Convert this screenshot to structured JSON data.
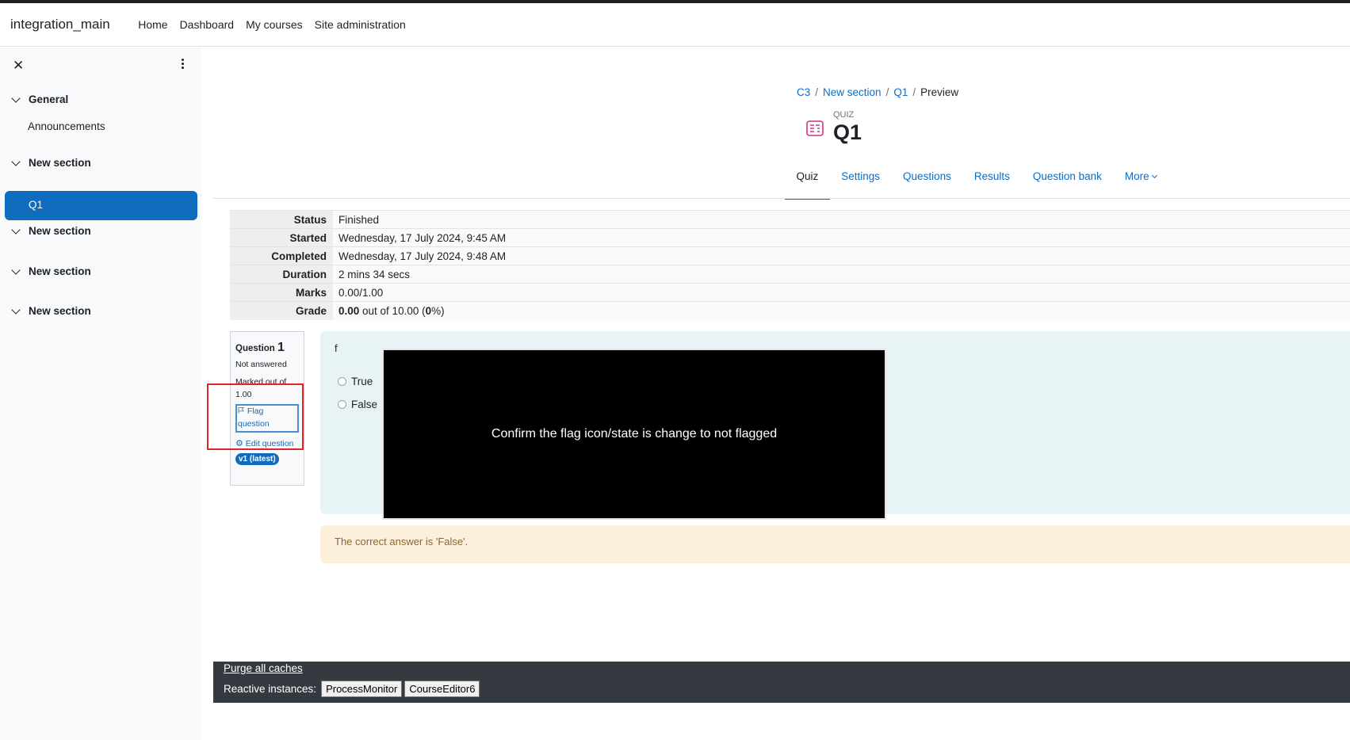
{
  "navbar": {
    "brand": "integration_main",
    "links": [
      "Home",
      "Dashboard",
      "My courses",
      "Site administration"
    ]
  },
  "drawer": {
    "close_glyph": "✕",
    "sections": [
      {
        "label": "General",
        "items": [
          "Announcements"
        ]
      },
      {
        "label": "New section",
        "items": [
          "Q1"
        ]
      },
      {
        "label": "New section",
        "items": []
      },
      {
        "label": "New section",
        "items": []
      },
      {
        "label": "New section",
        "items": []
      }
    ],
    "active_item": "Q1"
  },
  "breadcrumb": [
    "C3",
    "New section",
    "Q1",
    "Preview"
  ],
  "quiz": {
    "kind": "QUIZ",
    "title": "Q1"
  },
  "tabs": [
    "Quiz",
    "Settings",
    "Questions",
    "Results",
    "Question bank",
    "More"
  ],
  "summary": [
    {
      "label": "Status",
      "value": "Finished"
    },
    {
      "label": "Started",
      "value": "Wednesday, 17 July 2024, 9:45 AM"
    },
    {
      "label": "Completed",
      "value": "Wednesday, 17 July 2024, 9:48 AM"
    },
    {
      "label": "Duration",
      "value": "2 mins 34 secs"
    },
    {
      "label": "Marks",
      "value": "0.00/1.00"
    }
  ],
  "grade": {
    "label": "Grade",
    "score": "0.00",
    "mid": " out of 10.00 (",
    "pct": "0",
    "end": "%)"
  },
  "question_info": {
    "prefix": "Question",
    "number": "1",
    "state": "Not answered",
    "marked": "Marked out of 1.00",
    "flag_label": "Flag question",
    "edit_label": "Edit question",
    "version": "v1 (latest)"
  },
  "question": {
    "text": "f",
    "options": [
      "True",
      "False"
    ]
  },
  "overlay": {
    "message": "Confirm the flag icon/state is change to not flagged"
  },
  "feedback": {
    "text": "The correct answer is 'False'."
  },
  "footer": {
    "purge": "Purge all caches",
    "reactive_label": "Reactive instances:",
    "instances": [
      "ProcessMonitor",
      "CourseEditor6"
    ]
  },
  "colors": {
    "brand": "#0f6cbf",
    "quiz_icon": "#d63384",
    "highlight": "#e0242a"
  }
}
